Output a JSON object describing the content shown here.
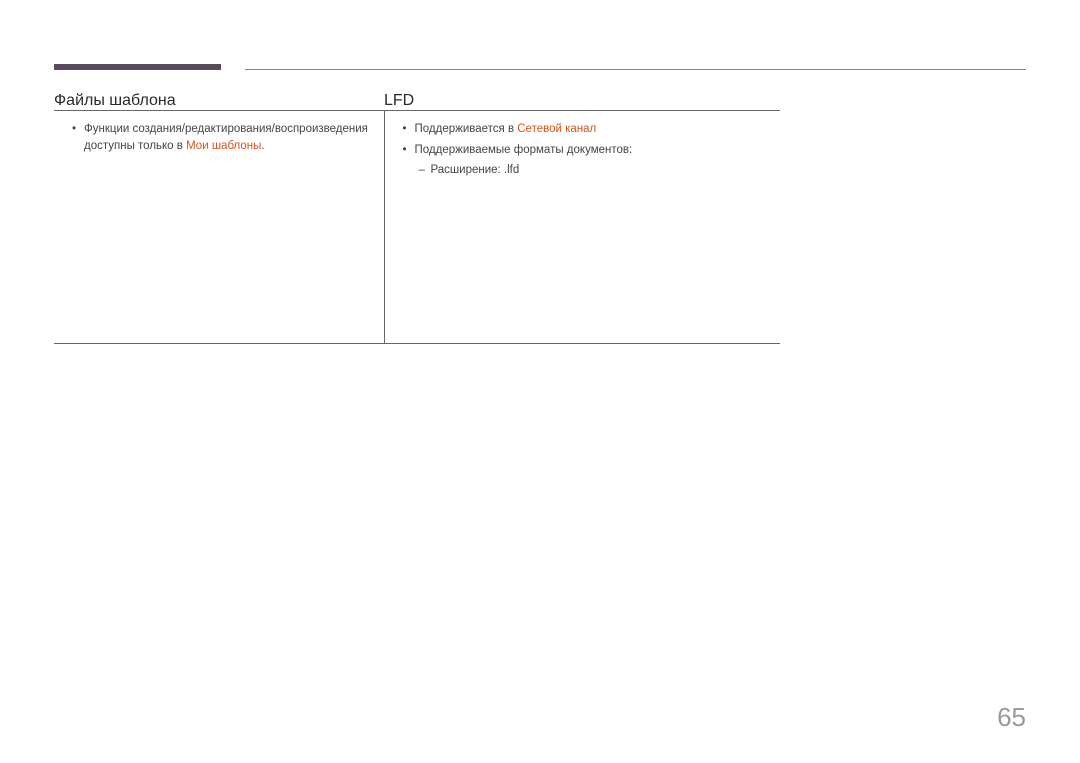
{
  "table": {
    "headers": {
      "left": "Файлы шаблона",
      "right": "LFD"
    },
    "left_cell": {
      "bullet1_part1": "Функции создания/редактирования/воспроизведения доступны только в ",
      "bullet1_hl": "Мои шаблоны",
      "bullet1_part2": "."
    },
    "right_cell": {
      "bullet1_part1": "Поддерживается в ",
      "bullet1_hl": "Сетевой канал",
      "bullet2": "Поддерживаемые форматы документов:",
      "bullet2_sub1": "Расширение: .lfd"
    }
  },
  "page_number": "65"
}
